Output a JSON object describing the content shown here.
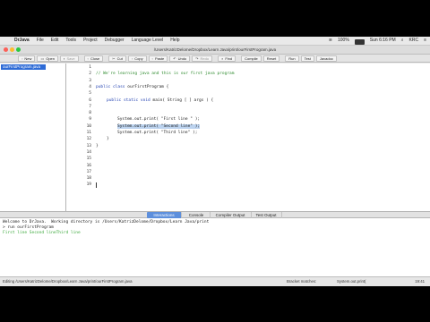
{
  "menubar": {
    "apple": "",
    "items": [
      "DrJava",
      "File",
      "Edit",
      "Tools",
      "Project",
      "Debugger",
      "Language Level",
      "Help"
    ],
    "battery": "100%",
    "clock": "Sun 6:16 PM",
    "user": "KRC"
  },
  "window": {
    "title": "/Users/KatrizDelome/Dropbox/Learn Java/print/ourFirstProgram.java"
  },
  "toolbar": {
    "buttons": [
      {
        "label": "New",
        "icon": "new-file-icon"
      },
      {
        "label": "Open",
        "icon": "open-folder-icon"
      },
      {
        "label": "Save",
        "icon": "save-icon"
      },
      {
        "label": "Close",
        "icon": "close-icon"
      },
      {
        "label": "Cut",
        "icon": "cut-icon"
      },
      {
        "label": "Copy",
        "icon": "copy-icon"
      },
      {
        "label": "Paste",
        "icon": "paste-icon"
      },
      {
        "label": "Undo",
        "icon": "undo-icon"
      },
      {
        "label": "Redo",
        "icon": "redo-icon"
      },
      {
        "label": "Find",
        "icon": "find-icon"
      },
      {
        "label": "Compile",
        "icon": "compile-icon"
      },
      {
        "label": "Reset",
        "icon": "reset-icon"
      },
      {
        "label": "Run",
        "icon": "run-icon"
      },
      {
        "label": "Test",
        "icon": "test-icon"
      },
      {
        "label": "Javadoc",
        "icon": "javadoc-icon"
      }
    ]
  },
  "sidebar": {
    "file": "ourFirstProgram.java"
  },
  "editor": {
    "line_numbers": [
      "1",
      "2",
      "3",
      "4",
      "5",
      "6",
      "7",
      "8",
      "9",
      "10",
      "11",
      "12",
      "13",
      "14",
      "15",
      "16",
      "17",
      "18",
      "19"
    ],
    "comment": "// We're learning java and this is our first java program",
    "class_keyword": "public class",
    "class_name": "ourFirstProgram {",
    "main_kw": "public static void",
    "main_rest": "main( String [ ] args ) {",
    "print_prefix": "System.out.print(",
    "line9_arg": " \"First line \" );",
    "line10_text": "System.out.print( \"Second line\" );",
    "line11_arg": " \"Third line\" );",
    "close_brace": "}"
  },
  "tabs": [
    "Interactions",
    "Console",
    "Compiler Output",
    "Test Output"
  ],
  "interactions": {
    "welcome": "Welcome to DrJava.  Working directory is /Users/KatrizDelome/Dropbox/Learn Java/print",
    "command": "> run ourFirstProgram",
    "output": "First line Second lineThird line"
  },
  "statusbar": {
    "editing": "Editing /Users/KatrizDelome/Dropbox/Learn Java/print/ourFirstProgram.java",
    "bracket": "Bracket matches:",
    "symbol": "System.out.print(",
    "position": "19:41"
  }
}
